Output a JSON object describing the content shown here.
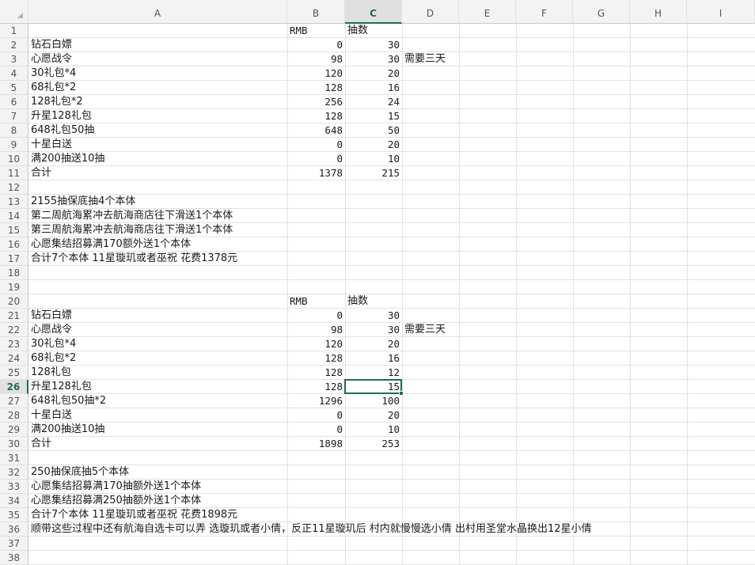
{
  "sheet": {
    "columns": [
      "A",
      "B",
      "C",
      "D",
      "E",
      "F",
      "G",
      "H",
      "I"
    ],
    "selected_column": "C",
    "selected_row": 26,
    "rows": [
      {
        "n": "1",
        "a": "",
        "b": "RMB",
        "c": "抽数",
        "d": ""
      },
      {
        "n": "2",
        "a": "钻石白嫖",
        "b": "0",
        "c": "30",
        "d": ""
      },
      {
        "n": "3",
        "a": "心愿战令",
        "b": "98",
        "c": "30",
        "d": "需要三天"
      },
      {
        "n": "4",
        "a": "30礼包*4",
        "b": "120",
        "c": "20",
        "d": ""
      },
      {
        "n": "5",
        "a": "68礼包*2",
        "b": "128",
        "c": "16",
        "d": ""
      },
      {
        "n": "6",
        "a": "128礼包*2",
        "b": "256",
        "c": "24",
        "d": ""
      },
      {
        "n": "7",
        "a": "升星128礼包",
        "b": "128",
        "c": "15",
        "d": ""
      },
      {
        "n": "8",
        "a": "648礼包50抽",
        "b": "648",
        "c": "50",
        "d": ""
      },
      {
        "n": "9",
        "a": "十星白送",
        "b": "0",
        "c": "20",
        "d": ""
      },
      {
        "n": "10",
        "a": "满200抽送10抽",
        "b": "0",
        "c": "10",
        "d": ""
      },
      {
        "n": "11",
        "a": "合计",
        "b": "1378",
        "c": "215",
        "d": ""
      },
      {
        "n": "12",
        "a": "",
        "b": "",
        "c": "",
        "d": ""
      },
      {
        "n": "13",
        "a": "2155抽保底抽4个本体",
        "b": "",
        "c": "",
        "d": ""
      },
      {
        "n": "14",
        "a": "第二周航海累冲去航海商店往下滑送1个本体",
        "b": "",
        "c": "",
        "d": ""
      },
      {
        "n": "15",
        "a": "第三周航海累冲去航海商店往下滑送1个本体",
        "b": "",
        "c": "",
        "d": ""
      },
      {
        "n": "16",
        "a": "心愿集结招募满170额外送1个本体",
        "b": "",
        "c": "",
        "d": ""
      },
      {
        "n": "17",
        "a": "合计7个本体 11星璇玑或者巫祝 花费1378元",
        "b": "",
        "c": "",
        "d": ""
      },
      {
        "n": "18",
        "a": "",
        "b": "",
        "c": "",
        "d": ""
      },
      {
        "n": "19",
        "a": "",
        "b": "",
        "c": "",
        "d": ""
      },
      {
        "n": "20",
        "a": "",
        "b": "RMB",
        "c": "抽数",
        "d": ""
      },
      {
        "n": "21",
        "a": "钻石白嫖",
        "b": "0",
        "c": "30",
        "d": ""
      },
      {
        "n": "22",
        "a": "心愿战令",
        "b": "98",
        "c": "30",
        "d": "需要三天"
      },
      {
        "n": "23",
        "a": "30礼包*4",
        "b": "120",
        "c": "20",
        "d": ""
      },
      {
        "n": "24",
        "a": "68礼包*2",
        "b": "128",
        "c": "16",
        "d": ""
      },
      {
        "n": "25",
        "a": "128礼包",
        "b": "128",
        "c": "12",
        "d": ""
      },
      {
        "n": "26",
        "a": "升星128礼包",
        "b": "128",
        "c": "15",
        "d": ""
      },
      {
        "n": "27",
        "a": "648礼包50抽*2",
        "b": "1296",
        "c": "100",
        "d": ""
      },
      {
        "n": "28",
        "a": "十星白送",
        "b": "0",
        "c": "20",
        "d": ""
      },
      {
        "n": "29",
        "a": "满200抽送10抽",
        "b": "0",
        "c": "10",
        "d": ""
      },
      {
        "n": "30",
        "a": "合计",
        "b": "1898",
        "c": "253",
        "d": ""
      },
      {
        "n": "31",
        "a": "",
        "b": "",
        "c": "",
        "d": ""
      },
      {
        "n": "32",
        "a": "250抽保底抽5个本体",
        "b": "",
        "c": "",
        "d": ""
      },
      {
        "n": "33",
        "a": "心愿集结招募满170抽额外送1个本体",
        "b": "",
        "c": "",
        "d": ""
      },
      {
        "n": "34",
        "a": "心愿集结招募满250抽额外送1个本体",
        "b": "",
        "c": "",
        "d": ""
      },
      {
        "n": "35",
        "a": "合计7个本体 11星璇玑或者巫祝 花费1898元",
        "b": "",
        "c": "",
        "d": ""
      },
      {
        "n": "36",
        "a": "顺带这些过程中还有航海自选卡可以弄  选璇玑或者小倩，反正11星璇玑后 村内就慢慢选小倩 出村用圣堂水晶换出12星小倩",
        "b": "",
        "c": "",
        "d": ""
      },
      {
        "n": "37",
        "a": "",
        "b": "",
        "c": "",
        "d": ""
      },
      {
        "n": "38",
        "a": "",
        "b": "",
        "c": "",
        "d": ""
      }
    ]
  }
}
